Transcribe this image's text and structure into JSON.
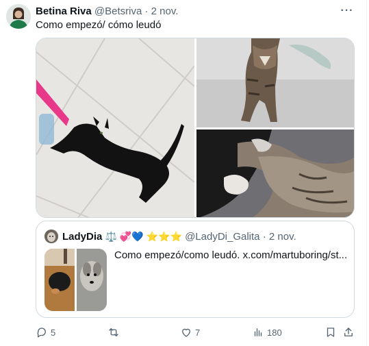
{
  "tweet": {
    "display_name": "Betina Riva",
    "handle": "@Betsriva",
    "separator": " · ",
    "date": "2 nov.",
    "more_glyph": "···",
    "text": "Como empezó/ cómo leudó",
    "media_labels": [
      "black-kitten-playing",
      "tabby-cat-standing",
      "cats-sleeping-together"
    ]
  },
  "quote": {
    "display_name": "LadyDia",
    "name_emojis": "⚖️ 💞💙 ⭐⭐⭐",
    "handle": "@LadyDi_Galita",
    "separator": " · ",
    "date": "2 nov.",
    "text": "Como empezó/como leudó.  x.com/martuboring/st..."
  },
  "actions": {
    "replies": "5",
    "reposts": "",
    "likes": "7",
    "views": "180"
  },
  "colors": {
    "text_primary": "#0f1419",
    "text_secondary": "#536471",
    "border": "#cfd9de"
  }
}
